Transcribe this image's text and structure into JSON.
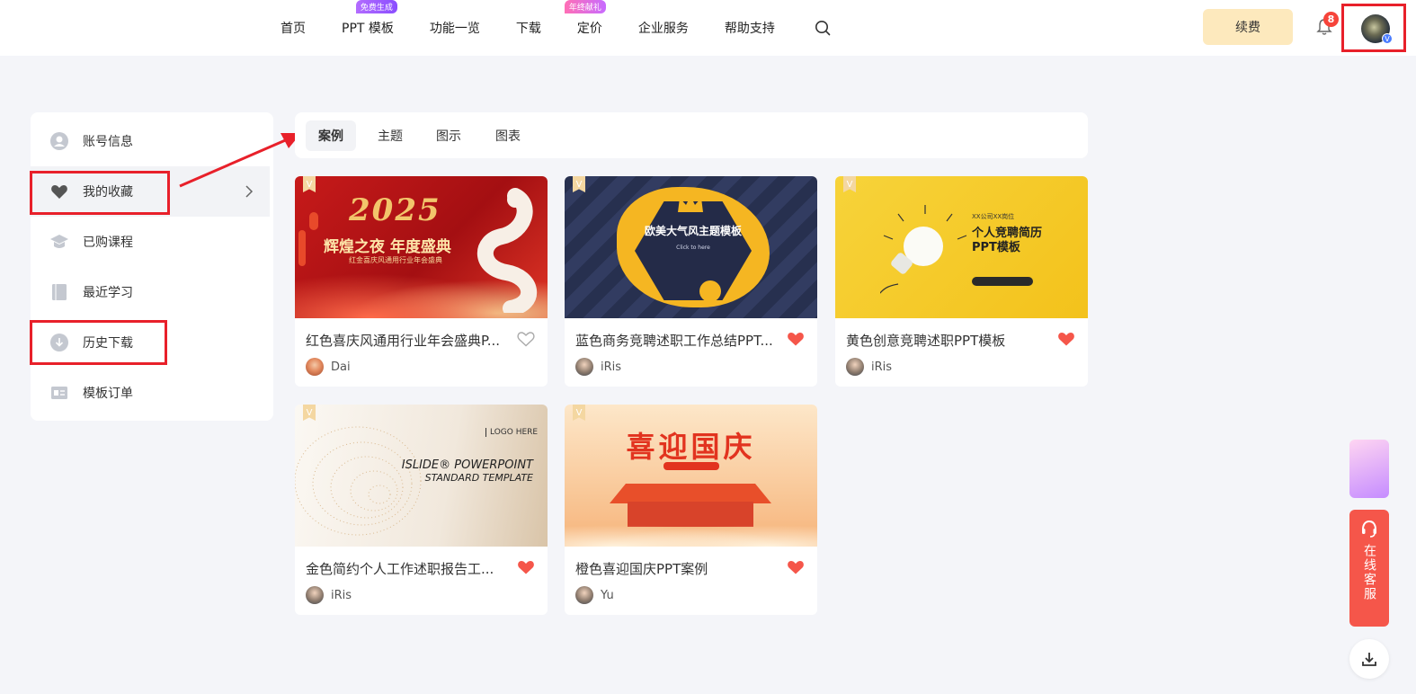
{
  "header": {
    "nav": [
      {
        "label": "首页",
        "badge": ""
      },
      {
        "label": "PPT 模板",
        "badge": "免费生成"
      },
      {
        "label": "功能一览",
        "badge": ""
      },
      {
        "label": "下载",
        "badge": ""
      },
      {
        "label": "定价",
        "badge": "年终献礼"
      },
      {
        "label": "企业服务",
        "badge": ""
      },
      {
        "label": "帮助支持",
        "badge": ""
      }
    ],
    "renew_label": "续费",
    "notification_count": "8",
    "avatar_badge": "V"
  },
  "sidebar": {
    "items": [
      {
        "label": "账号信息"
      },
      {
        "label": "我的收藏"
      },
      {
        "label": "已购课程"
      },
      {
        "label": "最近学习"
      },
      {
        "label": "历史下载"
      },
      {
        "label": "模板订单"
      }
    ]
  },
  "tabs": [
    "案例",
    "主题",
    "图示",
    "图表"
  ],
  "cards": [
    {
      "title": "红色喜庆风通用行业年会盛典P...",
      "author": "Dai",
      "favorited": false,
      "thumb": {
        "big": "2025",
        "line1": "辉煌之夜 年度盛典",
        "line2": "红金喜庆风通用行业年会盛典"
      }
    },
    {
      "title": "蓝色商务竞聘述职工作总结PPT...",
      "author": "iRis",
      "favorited": true,
      "thumb": {
        "line1": "欧美大气风主题模板",
        "line2": "Click to here"
      }
    },
    {
      "title": "黄色创意竞聘述职PPT模板",
      "author": "iRis",
      "favorited": true,
      "thumb": {
        "line0": "XX公司XX岗位",
        "line1": "个人竞聘简历",
        "line2": "PPT模板"
      }
    },
    {
      "title": "金色简约个人工作述职报告工...",
      "author": "iRis",
      "favorited": true,
      "thumb": {
        "logo": "LOGO HERE",
        "line1": "ISLIDE® POWERPOINT",
        "line2": "STANDARD TEMPLATE"
      }
    },
    {
      "title": "橙色喜迎国庆PPT案例",
      "author": "Yu",
      "favorited": true,
      "thumb": {
        "line1": "喜迎国庆"
      }
    }
  ],
  "card_vip_tag": "V",
  "float": {
    "service_label": "在线客服"
  },
  "colors": {
    "accent_red": "#e8202a",
    "heart": "#f5564a",
    "renew_bg": "#fde9bd"
  }
}
